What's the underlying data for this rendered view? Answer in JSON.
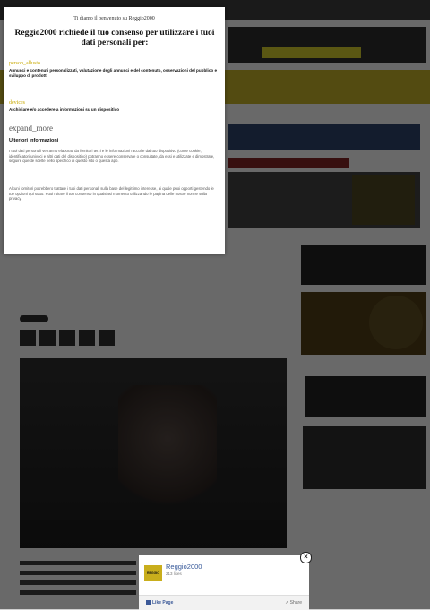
{
  "consent": {
    "welcome": "Ti diamo il benvenuto su Reggio2000",
    "heading": "Reggio2000 richiede il tuo consenso per utilizzare i tuoi dati personali per:",
    "sections": [
      {
        "title": "person_allusto",
        "body": "Annunci e contenuti personalizzati, valutazione degli annunci e del contenuto, osservazioni del pubblico e sviluppo di prodotti"
      },
      {
        "title": "devices",
        "body": "Archiviare e/o accedere a informazioni su un dispositivo"
      }
    ],
    "expand_label": "expand_more",
    "more_title": "Ulteriori informazioni",
    "para1": "I tuoi dati personali verranno elaborati da fornitori terzi e le informazioni raccolte dal tuo dispositivo (come cookie, identificatori univoci e altri dati del dispositivo) potranno essere conservate o consultate, da essi e utilizzate e dimostrate, seguire queste scelte nello specifico di questo sito o questa app.",
    "para2": "Alcuni fornitori potrebbero trattare i tuoi dati personali sulla base del legittimo interesse, ai quale puoi opporti gestendo le tue opzioni qui sotto. Puoi ritirare il tuo consenso in qualsiasi momento utilizzando le pagina delle nostre norme sulla privacy."
  },
  "fb_widget": {
    "page_name": "Reggio2000",
    "likes": "213 likes",
    "like_label": "Like Page",
    "share_label": "Share",
    "logo_text": "REGGIO"
  },
  "colors": {
    "accent": "#c8a900",
    "fb_blue": "#365899"
  }
}
